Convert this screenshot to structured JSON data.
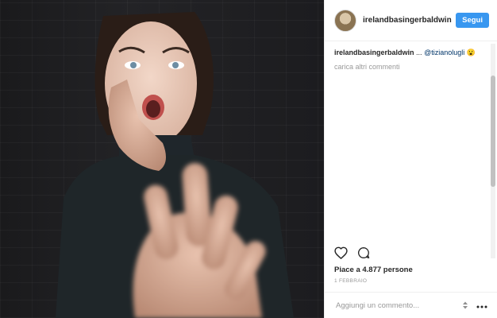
{
  "post": {
    "author": {
      "username": "irelandbasingerbaldwin"
    },
    "follow_label": "Segui",
    "caption": {
      "username": "irelandbasingerbaldwin",
      "ellipsis": "...",
      "mention": "@tizianolugli",
      "emoji": "😮"
    },
    "load_more_label": "carica altri commenti",
    "likes_text": "Piace a 4.877 persone",
    "date_text": "1 FEBBRAIO",
    "comment_placeholder": "Aggiungi un commento...",
    "colors": {
      "accent": "#3897f0",
      "mention": "#003569",
      "muted": "#999999"
    },
    "icons": {
      "like": "heart-icon",
      "comment": "comment-bubble-icon",
      "stepper": "stepper-icon",
      "more": "more-options-icon"
    }
  }
}
